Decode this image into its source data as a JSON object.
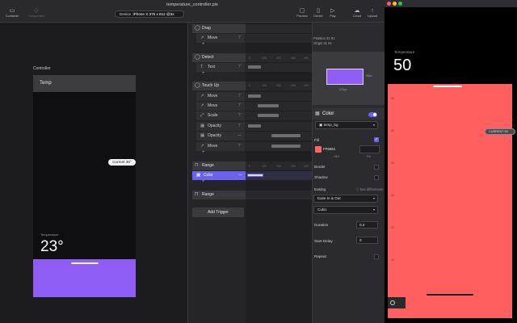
{
  "window": {
    "title": "temperature_controller.pie"
  },
  "toolbar": {
    "left_tools": [
      {
        "label": "Container",
        "icon": "container-icon"
      },
      {
        "label": "Component",
        "icon": "component-icon"
      }
    ],
    "device_label": "Device",
    "device_value": "iPhone X  375 x 812  @3x",
    "right_tools": [
      {
        "label": "Preview",
        "icon": "preview-icon"
      },
      {
        "label": "Device",
        "icon": "device-icon"
      },
      {
        "label": "Play",
        "icon": "play-icon"
      },
      {
        "label": "Cloud",
        "icon": "cloud-icon"
      },
      {
        "label": "Upload",
        "icon": "upload-icon"
      }
    ]
  },
  "canvas": {
    "frame_label": "Controller",
    "temp_bar": "Temp",
    "current_pill": "Current 30°",
    "temperature_label": "Temperature",
    "temperature_value": "23°"
  },
  "layers": {
    "triggers": [
      {
        "name": "Drag",
        "responses": [
          {
            "name": "Move",
            "icon": "move-icon"
          }
        ]
      },
      {
        "name": "Detect",
        "responses": [
          {
            "name": "Text",
            "icon": "text-icon"
          }
        ]
      },
      {
        "name": "Touch Up",
        "responses": [
          {
            "name": "Move",
            "icon": "move-icon"
          },
          {
            "name": "Move",
            "icon": "move-icon"
          },
          {
            "name": "Scale",
            "icon": "scale-icon"
          },
          {
            "name": "Opacity",
            "icon": "opacity-icon"
          },
          {
            "name": "Opacity",
            "icon": "opacity-icon"
          },
          {
            "name": "Move",
            "icon": "move-icon"
          }
        ]
      },
      {
        "name": "Range",
        "responses": [
          {
            "name": "Color",
            "icon": "color-icon",
            "selected": true
          }
        ]
      },
      {
        "name": "Range",
        "responses": []
      }
    ],
    "add_trigger": "Add Trigger"
  },
  "timeline": {
    "ruler_ticks": [
      "0",
      "100",
      "200",
      "300",
      "400"
    ]
  },
  "inspector": {
    "position": "Position  31  91",
    "origin": "Origin  31  91",
    "preview_width": "375px",
    "preview_height": "55px",
    "section_title": "Color",
    "layer_select": "temp_bg",
    "fill_label": "Fill",
    "fill_hex": "FF6661",
    "hex_caption": "HEX",
    "fill_caption": "Fill",
    "border_label": "Border",
    "shadow_label": "Shadow",
    "easing_label": "Easing",
    "see_differences": "See differences",
    "easing_value": "Ease In & Out",
    "curve_value": "Cubic",
    "duration_label": "Duration",
    "duration_value": "0.2",
    "start_delay_label": "Start Delay",
    "start_delay_value": "0",
    "repeat_label": "Repeat",
    "fill_color": "#ff6661",
    "accent_color": "#6a63f0"
  },
  "device_preview": {
    "temperature_label": "Temperature",
    "temperature_value": "50",
    "current_pill": "CURRENT 50",
    "ticks": [
      "60",
      "50",
      "40",
      "30",
      "20",
      "10"
    ],
    "background_color": "#ff5f5f"
  }
}
